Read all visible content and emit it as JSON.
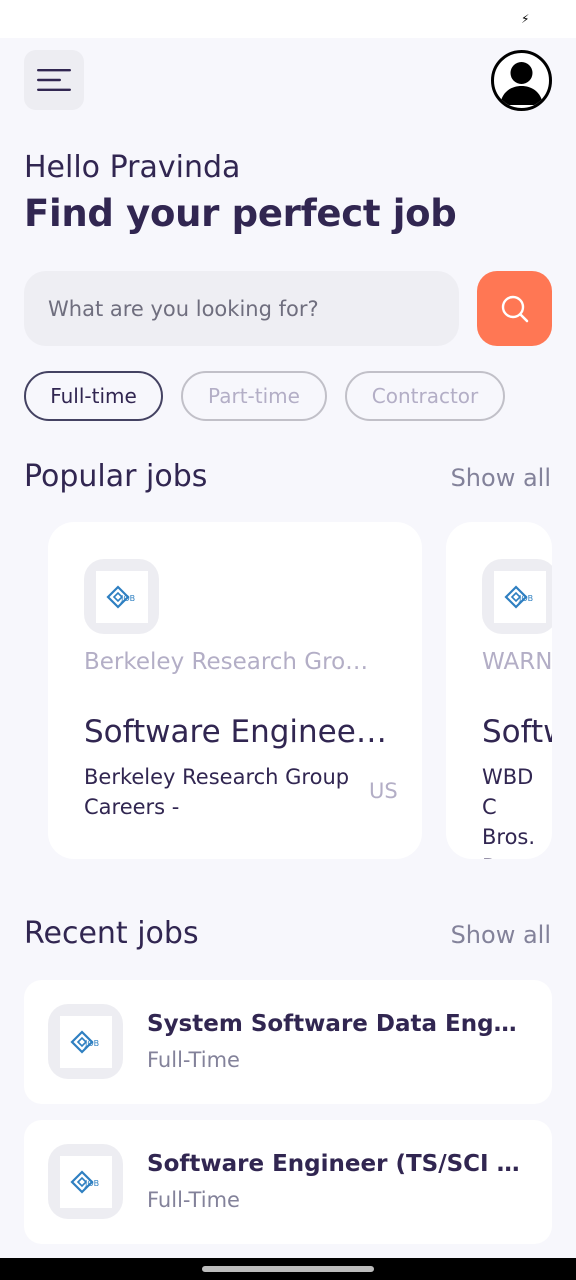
{
  "status_bar": {
    "charging_icon": "lightning-bolt-icon"
  },
  "header": {
    "menu_icon": "menu-icon",
    "avatar_icon": "user-avatar-icon"
  },
  "greeting": "Hello Pravinda",
  "headline": "Find your perfect job",
  "search": {
    "placeholder": "What are you looking for?",
    "value": "",
    "button_icon": "search-icon"
  },
  "job_types": [
    {
      "label": "Full-time",
      "active": true
    },
    {
      "label": "Part-time",
      "active": false
    },
    {
      "label": "Contractor",
      "active": false
    }
  ],
  "popular": {
    "title": "Popular jobs",
    "show_all": "Show all",
    "cards": [
      {
        "company": "Berkeley Research Gro…",
        "title": "Software Enginee…",
        "publisher": "Berkeley Research Group Careers -",
        "country": "US"
      },
      {
        "company": "WARN",
        "title": "Softw",
        "publisher": "WBD C Bros. D",
        "country": ""
      }
    ]
  },
  "recent": {
    "title": "Recent jobs",
    "show_all": "Show all",
    "items": [
      {
        "title": "System Software Data Eng…",
        "type": "Full-Time"
      },
      {
        "title": "Software Engineer (TS/SCI …",
        "type": "Full-Time"
      }
    ]
  },
  "colors": {
    "accent": "#FF7754",
    "primary": "#312651",
    "background": "#F7F7FC",
    "gray": "#83829A"
  }
}
